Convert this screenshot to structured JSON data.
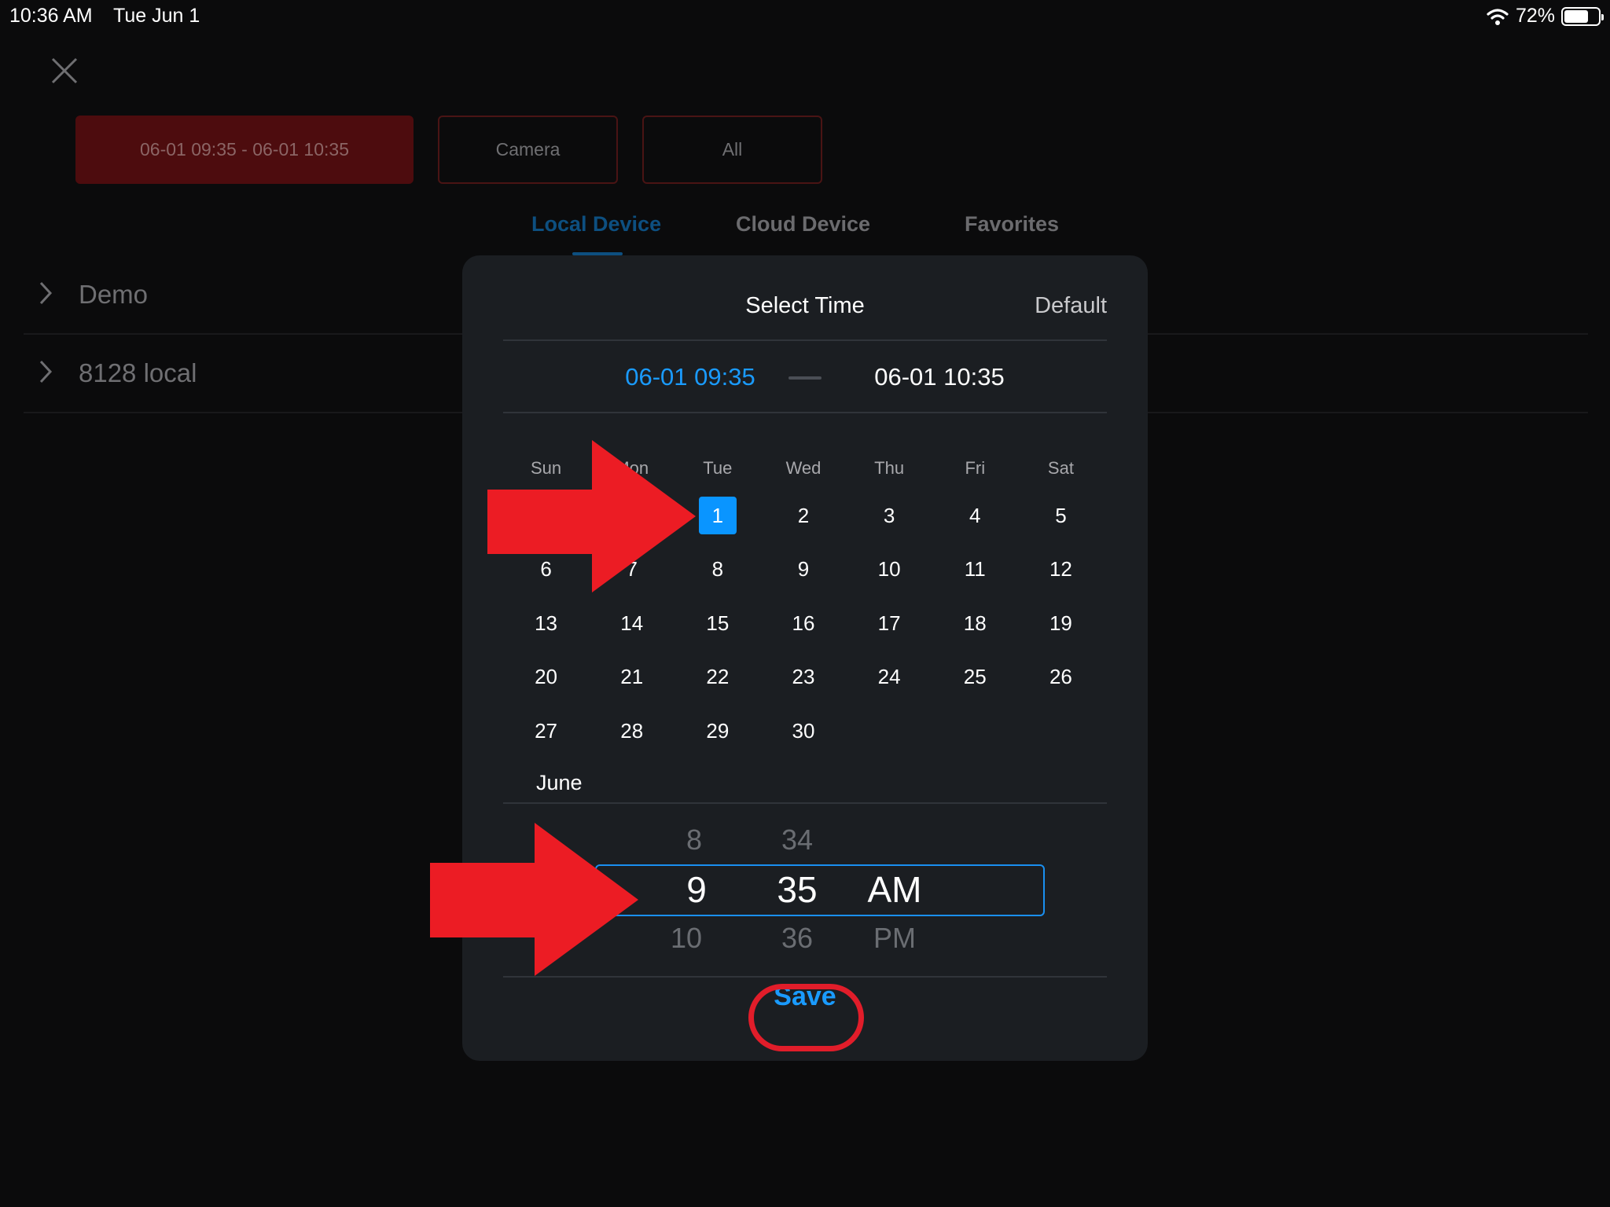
{
  "status_bar": {
    "time": "10:36 AM",
    "date": "Tue Jun 1",
    "battery_percent_label": "72%",
    "battery_level": 0.72
  },
  "filters": {
    "time_range": "06-01 09:35 - 06-01 10:35",
    "camera": "Camera",
    "all": "All"
  },
  "tabs": [
    "Local Device",
    "Cloud Device",
    "Favorites"
  ],
  "active_tab": "Local Device",
  "devices": [
    "Demo",
    "8128 local"
  ],
  "modal": {
    "title": "Select Time",
    "default_label": "Default",
    "range_start": "06-01 09:35",
    "range_end": "06-01 10:35",
    "weekdays": [
      "Sun",
      "Mon",
      "Tue",
      "Wed",
      "Thu",
      "Fri",
      "Sat"
    ],
    "month": "June",
    "days": [
      "1",
      "2",
      "3",
      "4",
      "5",
      "6",
      "7",
      "8",
      "9",
      "10",
      "11",
      "12",
      "13",
      "14",
      "15",
      "16",
      "17",
      "18",
      "19",
      "20",
      "21",
      "22",
      "23",
      "24",
      "25",
      "26",
      "27",
      "28",
      "29",
      "30"
    ],
    "selected_day": "1",
    "picker": {
      "hour_prev": "8",
      "hour_cur": "9",
      "hour_next": "10",
      "minute_prev": "34",
      "minute_cur": "35",
      "minute_next": "36",
      "ampm_cur": "AM",
      "ampm_next": "PM"
    },
    "save_label": "Save"
  },
  "colors": {
    "accent_blue": "#1a9bff",
    "selected_day_bg": "#0a95ff",
    "annotation_red": "#ec1c24",
    "modal_bg": "#1b1e22"
  }
}
